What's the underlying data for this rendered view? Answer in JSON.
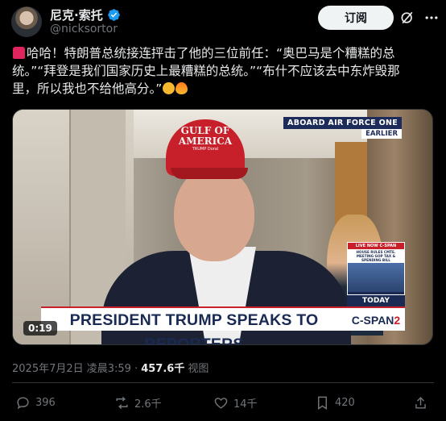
{
  "author": {
    "display_name": "尼克·索托",
    "handle": "@nicksortor",
    "verified": true
  },
  "header": {
    "subscribe_label": "订阅",
    "grok_icon": "grok-icon",
    "more_icon": "more-icon"
  },
  "tweet": {
    "lines": [
      "哈哈！特朗普总统接连抨击了他的三位前任：“奥巴马是个糟糕的总",
      "统。”“拜登是我们国家历史上最糟糕的总统。”“布什不应该去中东炸毁那",
      "里，所以我也不给他高分。”"
    ],
    "leading_emoji": "siren-emoji",
    "trailing_emojis": [
      "rofl-emoji",
      "fire-emoji"
    ]
  },
  "video": {
    "duration": "0:19",
    "badge_aboard": "ABOARD AIR FORCE ONE",
    "badge_earlier": "EARLIER",
    "cap_line1": "GULF OF",
    "cap_line2": "AMERICA",
    "cap_line3": "TRUMP Doral",
    "mini_live": "LIVE NOW C-SPAN",
    "mini_sub": "HOUSE RULES CMTE. MEETING GOP TAX & SPENDING BILL",
    "today": "TODAY",
    "headline": "PRESIDENT TRUMP SPEAKS TO REPORTERS",
    "network": "C-SPAN",
    "network_num": "2"
  },
  "meta": {
    "timestamp": "2025年7月2日 凌晨3:59 · ",
    "views": "457.6千",
    "views_label": "视图"
  },
  "actions": {
    "replies": "396",
    "reposts": "2.6千",
    "likes": "14千",
    "bookmarks": "420"
  },
  "colors": {
    "background": "#000000",
    "text": "#e7e9ea",
    "muted": "#71767b",
    "verified": "#1d9bf0",
    "cspan_red": "#c8202a",
    "cspan_navy": "#1a2a52"
  }
}
